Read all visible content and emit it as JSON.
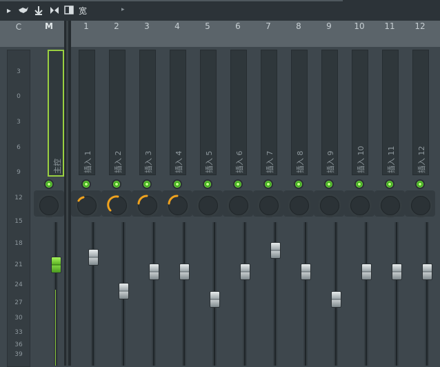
{
  "toolbar": {
    "icons": [
      "play-arrow-icon",
      "bird-icon",
      "anchor-icon",
      "speaker-icon",
      "panel-icon"
    ],
    "width_label": "宽",
    "arrow_glyph": "▸"
  },
  "header": {
    "current_label": "C",
    "master_label": "M",
    "inserts": [
      "1",
      "2",
      "3",
      "4",
      "5",
      "6",
      "7",
      "8",
      "9",
      "10",
      "11",
      "12"
    ]
  },
  "scale": {
    "labels": [
      "3",
      "0",
      "3",
      "6",
      "9",
      "12",
      "15",
      "18",
      "21",
      "24",
      "27",
      "30",
      "33",
      "36",
      "39"
    ]
  },
  "master": {
    "name": "主控",
    "fader_level": 0.72
  },
  "mixer_tracks": [
    {
      "name": "插入 1",
      "fader_level": 0.78,
      "knob_arc": "small"
    },
    {
      "name": "插入 2",
      "fader_level": 0.52,
      "knob_arc": "large"
    },
    {
      "name": "插入 3",
      "fader_level": 0.67,
      "knob_arc": "medium"
    },
    {
      "name": "插入 4",
      "fader_level": 0.67,
      "knob_arc": "medium"
    },
    {
      "name": "插入 5",
      "fader_level": 0.46,
      "knob_arc": "none"
    },
    {
      "name": "插入 6",
      "fader_level": 0.67,
      "knob_arc": "none"
    },
    {
      "name": "插入 7",
      "fader_level": 0.83,
      "knob_arc": "none"
    },
    {
      "name": "插入 8",
      "fader_level": 0.67,
      "knob_arc": "none"
    },
    {
      "name": "插入 9",
      "fader_level": 0.46,
      "knob_arc": "none"
    },
    {
      "name": "插入 10",
      "fader_level": 0.67,
      "knob_arc": "none"
    },
    {
      "name": "插入 11",
      "fader_level": 0.67,
      "knob_arc": "none"
    },
    {
      "name": "插入 12",
      "fader_level": 0.67,
      "knob_arc": "none"
    }
  ],
  "colors": {
    "accent_green": "#9ad041",
    "knob_arc_orange": "#f0a21e",
    "background": "#3e474d"
  }
}
